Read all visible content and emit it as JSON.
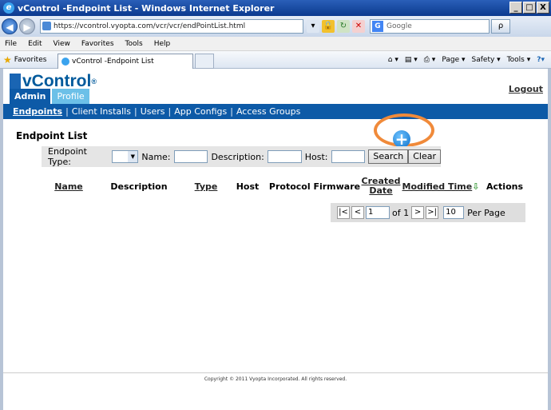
{
  "window": {
    "title": "vControl -Endpoint List - Windows Internet Explorer",
    "buttons": [
      "_",
      "□",
      "X"
    ]
  },
  "address_bar": {
    "url": "https://vcontrol.vyopta.com/vcr/vcr/endPointList.html",
    "search_placeholder": "Google",
    "search_go": "ρ"
  },
  "menu": [
    "File",
    "Edit",
    "View",
    "Favorites",
    "Tools",
    "Help"
  ],
  "favorites_bar": {
    "favorites_label": "Favorites",
    "tab_title": "vControl -Endpoint List",
    "commands": [
      "Page ▾",
      "Safety ▾",
      "Tools ▾"
    ]
  },
  "app": {
    "logo": "vControl",
    "logo_mark": "®",
    "tabs": [
      "Admin",
      "Profile"
    ],
    "logout": "Logout",
    "subnav": [
      "Endpoints",
      "Client Installs",
      "Users",
      "App Configs",
      "Access Groups"
    ],
    "page_title": "Endpoint List",
    "add_icon": "+"
  },
  "filter": {
    "endpoint_type_label": "Endpoint Type:",
    "name_label": "Name:",
    "description_label": "Description:",
    "host_label": "Host:",
    "search_button": "Search",
    "clear_button": "Clear"
  },
  "columns": {
    "name": "Name",
    "description": "Description",
    "type": "Type",
    "host": "Host",
    "protocol_firmware": "Protocol Firmware",
    "created_date": "Created Date",
    "modified_time": "Modified Time",
    "sort_indicator": "⇩",
    "actions": "Actions"
  },
  "pager": {
    "first": "|<",
    "prev": "<",
    "page_value": "1",
    "of_label": "of 1",
    "next": ">",
    "last": ">|",
    "per_page_value": "10",
    "per_page_label": "Per Page"
  },
  "footer": "Copyright © 2011 Vyopta Incorporated. All rights reserved."
}
